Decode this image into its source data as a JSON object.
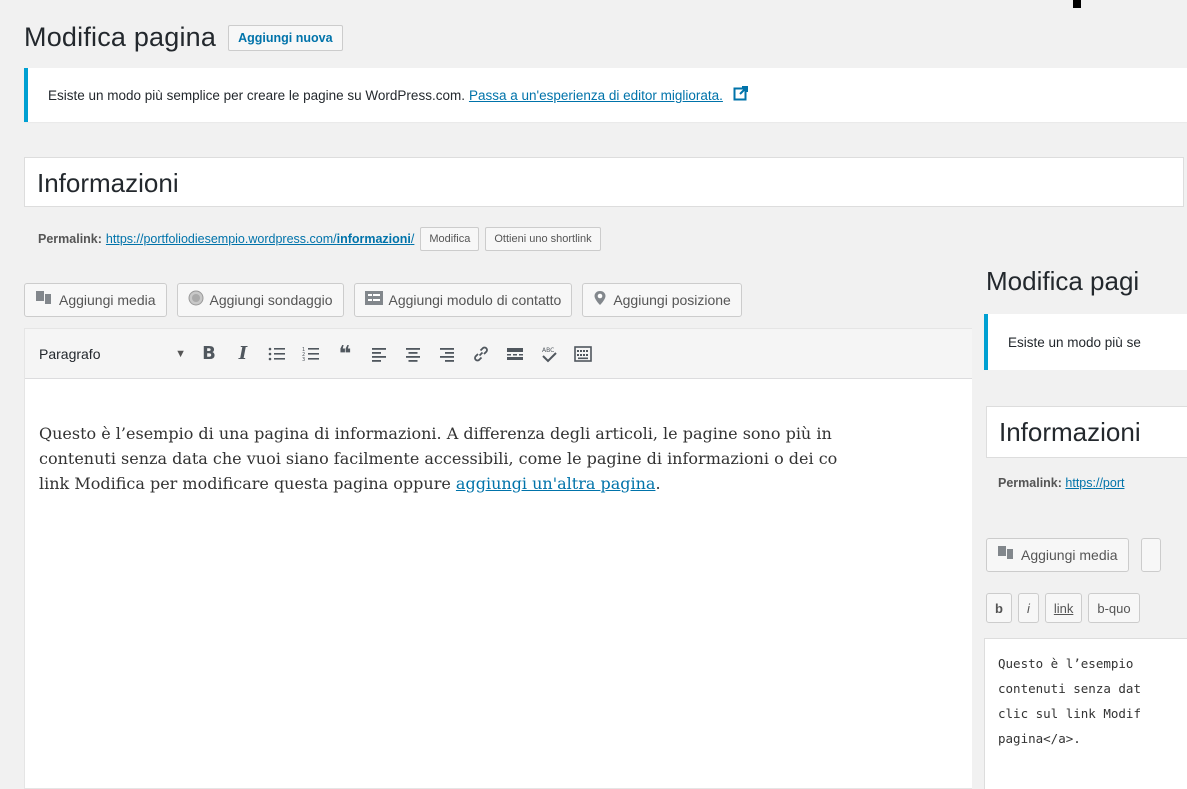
{
  "main": {
    "title": "Modifica pagina",
    "add_new_label": "Aggiungi nuova",
    "notice_text": "Esiste un modo più semplice per creare le pagine su WordPress.com.",
    "notice_link": "Passa a un'esperienza di editor migliorata.",
    "post_title": "Informazioni",
    "permalink_label": "Permalink:",
    "permalink_base": "https://portfoliodiesempio.wordpress.com/",
    "permalink_slug": "informazioni",
    "permalink_trailing": "/",
    "permalink_edit": "Modifica",
    "shortlink": "Ottieni uno shortlink",
    "media_buttons": [
      {
        "label": "Aggiungi media",
        "icon": "media-icon"
      },
      {
        "label": "Aggiungi sondaggio",
        "icon": "poll-icon"
      },
      {
        "label": "Aggiungi modulo di contatto",
        "icon": "form-icon"
      },
      {
        "label": "Aggiungi posizione",
        "icon": "location-icon"
      }
    ],
    "format_select": "Paragrafo",
    "toolbar_icons": [
      "bold-icon",
      "italic-icon",
      "bullet-list-icon",
      "numbered-list-icon",
      "blockquote-icon",
      "align-left-icon",
      "align-center-icon",
      "align-right-icon",
      "link-icon",
      "read-more-icon",
      "spellcheck-icon",
      "toolbar-toggle-icon"
    ],
    "content_line1": "Questo è l’esempio di una pagina di informazioni. A differenza degli articoli, le pagine sono più in",
    "content_line2": "contenuti senza data che vuoi siano facilmente accessibili, come le pagine di informazioni o dei co",
    "content_line3_pre": "link Modifica per modificare questa pagina oppure ",
    "content_line3_link": "aggiungi un'altra pagina",
    "content_line3_post": "."
  },
  "overlay": {
    "title": "Modifica pagi",
    "notice_text": "Esiste un modo più se",
    "post_title": "Informazioni",
    "permalink_label": "Permalink:",
    "permalink_url": "https://port",
    "media_label": "Aggiungi media",
    "quicktags": [
      "b",
      "i",
      "link",
      "b-quo"
    ],
    "text_lines": [
      "Questo è l’esempio",
      "contenuti senza dat",
      "clic sul link Modif",
      "pagina</a>."
    ]
  }
}
